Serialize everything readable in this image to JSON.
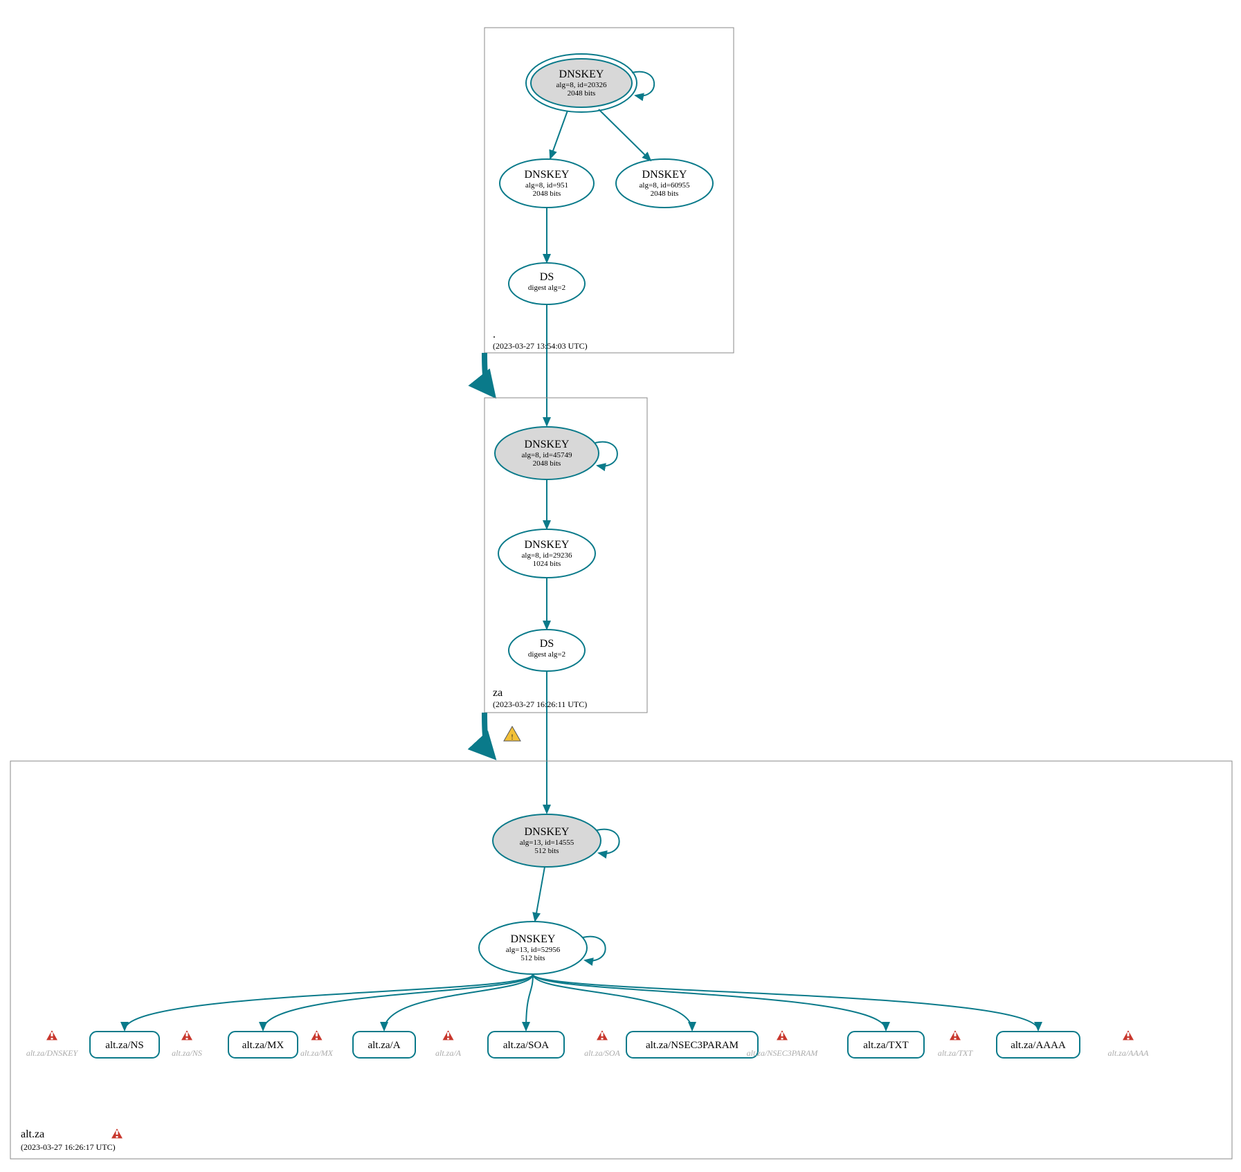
{
  "colors": {
    "accent": "#0a7a8a",
    "kskFill": "#d8d8d8",
    "warnRed": "#c8372d",
    "warnYellow": "#f2c037"
  },
  "zones": {
    "root": {
      "label": ".",
      "timestamp": "(2023-03-27 13:54:03 UTC)",
      "ksk": {
        "title": "DNSKEY",
        "line2": "alg=8, id=20326",
        "line3": "2048 bits"
      },
      "zskLeft": {
        "title": "DNSKEY",
        "line2": "alg=8, id=951",
        "line3": "2048 bits"
      },
      "zskRight": {
        "title": "DNSKEY",
        "line2": "alg=8, id=60955",
        "line3": "2048 bits"
      },
      "ds": {
        "title": "DS",
        "line2": "digest alg=2"
      }
    },
    "za": {
      "label": "za",
      "timestamp": "(2023-03-27 16:26:11 UTC)",
      "ksk": {
        "title": "DNSKEY",
        "line2": "alg=8, id=45749",
        "line3": "2048 bits"
      },
      "zsk": {
        "title": "DNSKEY",
        "line2": "alg=8, id=29236",
        "line3": "1024 bits"
      },
      "ds": {
        "title": "DS",
        "line2": "digest alg=2"
      }
    },
    "altza": {
      "label": "alt.za",
      "timestamp": "(2023-03-27 16:26:17 UTC)",
      "ksk": {
        "title": "DNSKEY",
        "line2": "alg=13, id=14555",
        "line3": "512 bits"
      },
      "zsk": {
        "title": "DNSKEY",
        "line2": "alg=13, id=52956",
        "line3": "512 bits"
      },
      "rrsets": [
        {
          "label": "alt.za/NS",
          "ghost": "alt.za/DNSKEY"
        },
        {
          "label": "alt.za/MX",
          "ghost": "alt.za/NS"
        },
        {
          "label": "alt.za/A",
          "ghost": "alt.za/MX"
        },
        {
          "label": "alt.za/SOA",
          "ghost": "alt.za/A"
        },
        {
          "label": "alt.za/NSEC3PARAM",
          "ghost": "alt.za/SOA"
        },
        {
          "label": "alt.za/TXT",
          "ghost": "alt.za/NSEC3PARAM"
        },
        {
          "label": "alt.za/AAAA",
          "ghost": "alt.za/TXT"
        }
      ],
      "trailingGhost": "alt.za/AAAA"
    }
  }
}
